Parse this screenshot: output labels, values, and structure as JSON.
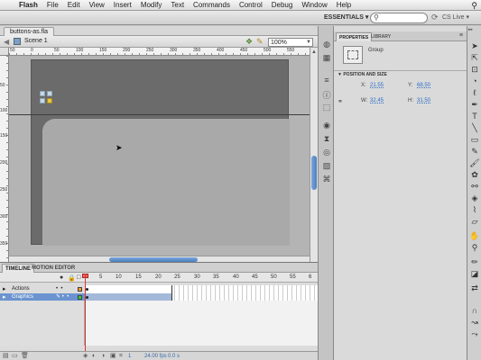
{
  "menubar": {
    "app": "Flash",
    "items": [
      "File",
      "Edit",
      "View",
      "Insert",
      "Modify",
      "Text",
      "Commands",
      "Control",
      "Debug",
      "Window",
      "Help"
    ]
  },
  "appbar": {
    "workspace": "ESSENTIALS ▾",
    "search_placeholder": "",
    "cs_live": "CS Live ▾"
  },
  "document": {
    "tab": "buttons-as.fla",
    "scene": "Scene 1",
    "zoom": "100%",
    "ruler_top": [
      "50",
      "0",
      "50",
      "100",
      "150",
      "200",
      "250",
      "300",
      "350",
      "400",
      "450",
      "500",
      "550"
    ],
    "ruler_left": [
      "50",
      "100",
      "150",
      "200",
      "250",
      "300",
      "350"
    ]
  },
  "timeline": {
    "tabs": [
      "TIMELINE",
      "MOTION EDITOR"
    ],
    "frame_numbers": [
      "5",
      "10",
      "15",
      "20",
      "25",
      "30",
      "35",
      "40",
      "45",
      "50",
      "55",
      "6"
    ],
    "layers": [
      {
        "name": "Actions",
        "color": "#ff9933"
      },
      {
        "name": "Graphics",
        "color": "#33cc33"
      }
    ],
    "footer": {
      "frame": "1",
      "fps": "24.00 fps",
      "time": "0.0 s"
    }
  },
  "properties": {
    "tabs": [
      "PROPERTIES",
      "LIBRARY"
    ],
    "instance_type": "Group",
    "section": "POSITION AND SIZE",
    "x_label": "X:",
    "x": "21.55",
    "y_label": "Y:",
    "y": "68.50",
    "w_label": "W:",
    "w": "32.45",
    "h_label": "H:",
    "h": "31.50"
  }
}
